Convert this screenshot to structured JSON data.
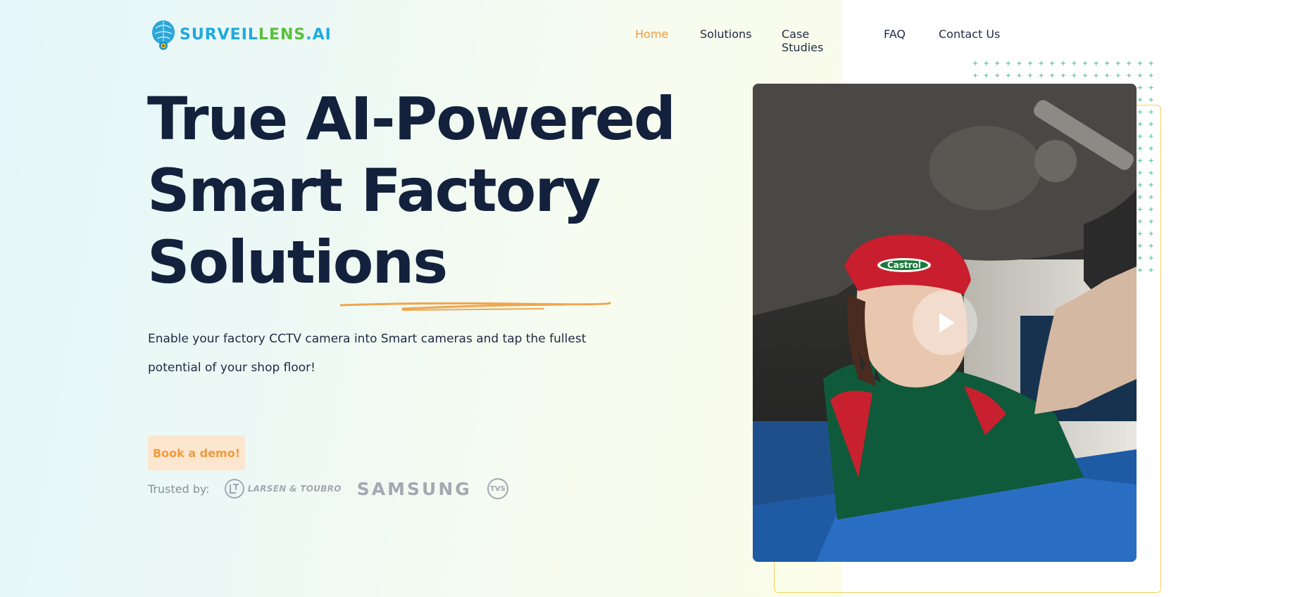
{
  "brand": {
    "name_part1": "SURVEIL",
    "name_part2": "LENS",
    "name_part3": ".AI"
  },
  "nav": {
    "items": [
      {
        "label": "Home",
        "active": true
      },
      {
        "label": "Solutions",
        "active": false
      },
      {
        "label": "Case Studies",
        "active": false
      },
      {
        "label": "FAQ",
        "active": false
      },
      {
        "label": "Contact Us",
        "active": false
      }
    ]
  },
  "hero": {
    "title_line1": "True AI-Powered",
    "title_line2": "Smart Factory",
    "title_line3": "Solutions",
    "subtitle": "Enable your factory CCTV camera into Smart cameras and tap the fullest potential of your shop floor!",
    "cta_label": "Book a demo!"
  },
  "trusted": {
    "label": "Trusted by:",
    "partners": {
      "lt": "LARSEN & TOUBRO",
      "samsung": "SAMSUNG",
      "tvs": "TVS"
    }
  },
  "video": {
    "cap_logo_text": "Castrol",
    "play_icon": "play-icon"
  },
  "colors": {
    "accent": "#f09a3e",
    "heading": "#14213d",
    "brand_blue": "#1eaadf",
    "brand_green": "#5bbf3c",
    "frame_yellow": "#f6d15a",
    "dot_green": "#5cc7a0"
  }
}
